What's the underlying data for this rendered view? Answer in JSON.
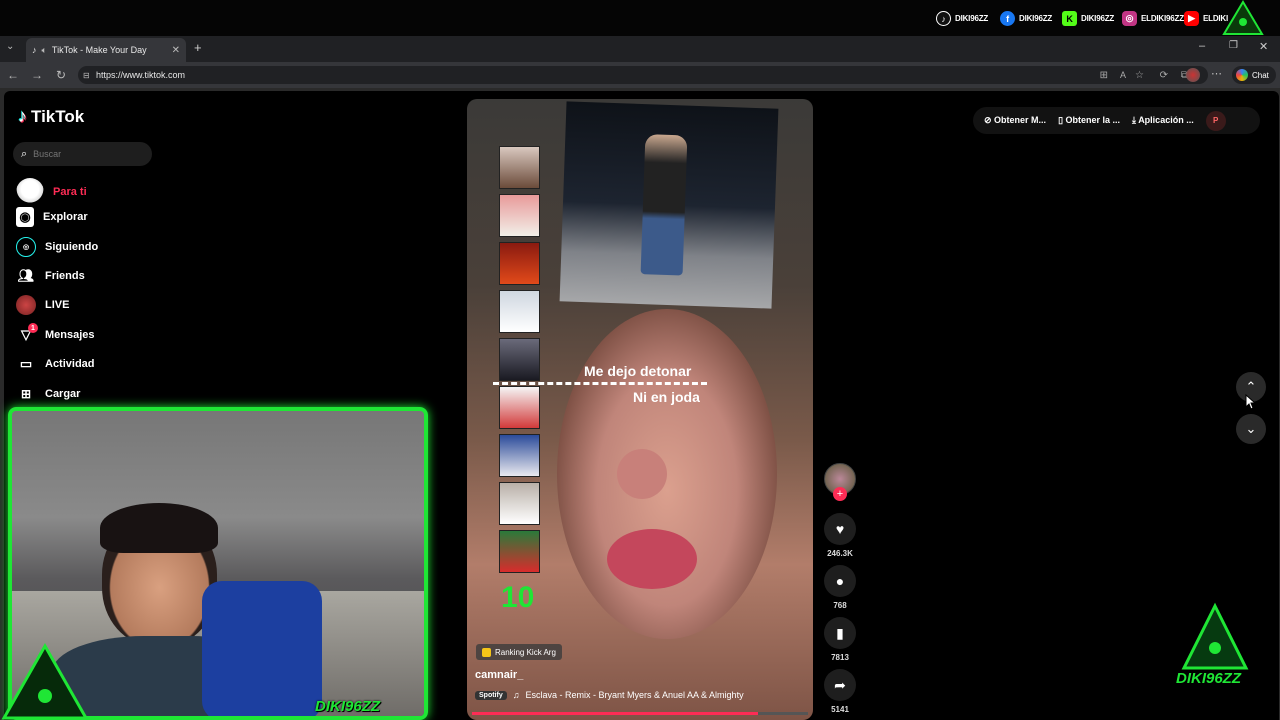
{
  "stream_overlay": {
    "socials": [
      {
        "platform_icon": "tiktok-icon",
        "handle": "DIKI96ZZ",
        "color": "#000000"
      },
      {
        "platform_icon": "facebook-icon",
        "handle": "DIKI96ZZ",
        "color": "#1877f2"
      },
      {
        "platform_icon": "kick-icon",
        "handle": "DIKI96ZZ",
        "color": "#53fc18"
      },
      {
        "platform_icon": "instagram-icon",
        "handle": "ELDIKI96ZZ",
        "color": "#c13584"
      },
      {
        "platform_icon": "youtube-icon",
        "handle": "ELDIKI",
        "color": "#ff0000"
      }
    ],
    "watermark": "DIKI96ZZ",
    "cam_label": "DIKI96ZZ",
    "accent": "#1fe635"
  },
  "browser": {
    "tab_title": "TikTok - Make Your Day",
    "url": "https://www.tiktok.com",
    "chat_label": "Chat"
  },
  "tiktok": {
    "logo": "TikTok",
    "search_placeholder": "Buscar",
    "nav": [
      {
        "icon": "home-icon",
        "label": "Para ti",
        "active": true
      },
      {
        "icon": "compass-icon",
        "label": "Explorar"
      },
      {
        "icon": "following-icon",
        "label": "Siguiendo"
      },
      {
        "icon": "friends-icon",
        "label": "Friends"
      },
      {
        "icon": "live-icon",
        "label": "LIVE"
      },
      {
        "icon": "send-icon",
        "label": "Mensajes",
        "badge": "1"
      },
      {
        "icon": "activity-icon",
        "label": "Actividad"
      },
      {
        "icon": "upload-icon",
        "label": "Cargar"
      }
    ],
    "top_actions": [
      "Obtener M...",
      "Obtener la ...",
      "Aplicación ..."
    ],
    "avatar_letter": "P",
    "video": {
      "caption_line1": "Me dejo detonar",
      "caption_line2": "Ni en joda",
      "rank_number": "10",
      "effect_tag": "Ranking Kick Arg",
      "username": "camnair_",
      "music_source": "Spotify",
      "music": "Esclava - Remix - Bryant Myers & Anuel AA & Almighty",
      "likes": "246.3K",
      "comments": "768",
      "saves": "7813",
      "shares": "5141"
    }
  }
}
